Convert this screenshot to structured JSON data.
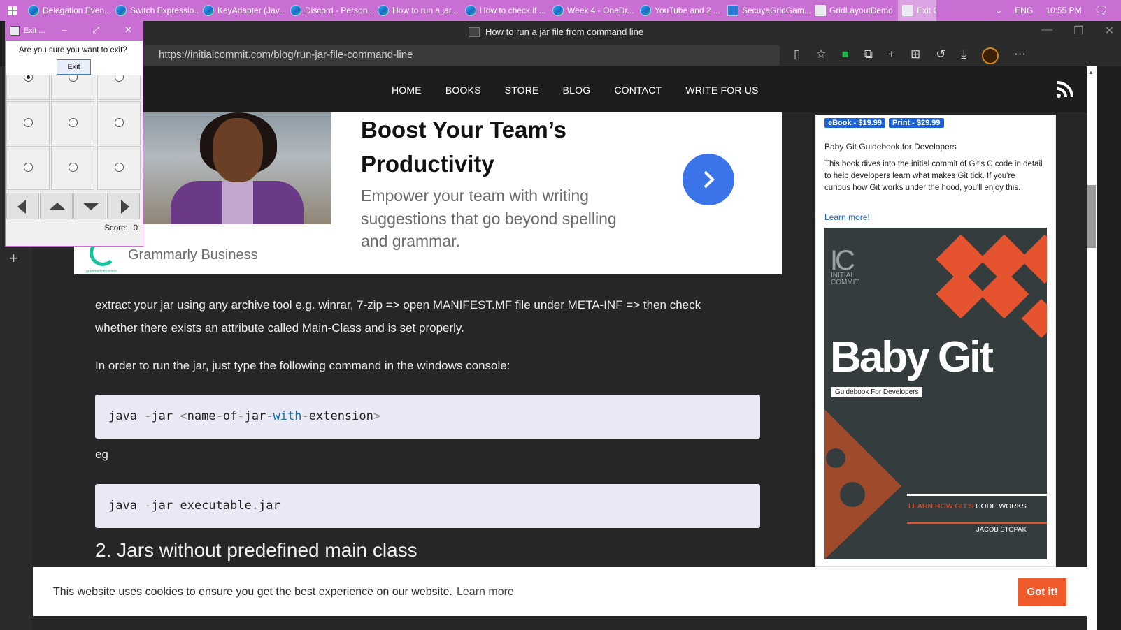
{
  "taskbar": {
    "items": [
      {
        "label": "Delegation Even..."
      },
      {
        "label": "Switch Expressio..."
      },
      {
        "label": "KeyAdapter (Jav..."
      },
      {
        "label": "Discord - Person..."
      },
      {
        "label": "How to run a jar..."
      },
      {
        "label": "How to check if ..."
      },
      {
        "label": "Week 4 - OneDr..."
      },
      {
        "label": "YouTube and 2 ..."
      },
      {
        "label": "SecuyaGridGam..."
      },
      {
        "label": "GridLayoutDemo"
      },
      {
        "label": "Exit G..."
      }
    ],
    "language": "ENG",
    "time": "10:55 PM"
  },
  "browser": {
    "title": "How to run a jar file from command line",
    "url": "https://initialcommit.com/blog/run-jar-file-command-line"
  },
  "site": {
    "nav": [
      "HOME",
      "BOOKS",
      "STORE",
      "BLOG",
      "CONTACT",
      "WRITE FOR US"
    ]
  },
  "ad": {
    "headline": "Boost Your Team’s Productivity",
    "body": "Empower your team with writing suggestions that go beyond spelling and grammar.",
    "brand": "Grammarly Business",
    "logo_sub": "grammarly business"
  },
  "article": {
    "p1": "extract your jar using any archive tool e.g. winrar, 7-zip => open MANIFEST.MF file under META-INF => then check whether there exists an attribute called Main-Class and is set properly.",
    "p2": "In order to run the jar, just type the following command in the windows console:",
    "code1": {
      "a": "java ",
      "b": "-",
      "c": "jar ",
      "d": "<",
      "e": "name",
      "f": "-",
      "g": "of",
      "h": "-",
      "i": "jar",
      "j": "-",
      "k": "with",
      "l": "-",
      "m": "extension",
      "n": ">"
    },
    "eg": "eg",
    "code2": {
      "a": "java ",
      "b": "-",
      "c": "jar executable",
      "d": ".",
      "e": "jar"
    },
    "h2": "2. Jars without predefined main class"
  },
  "book": {
    "ebook": "eBook - $19.99",
    "print": "Print - $29.99",
    "title": "Baby Git Guidebook for Developers",
    "desc": "This book dives into the initial commit of Git's C code in detail to help developers learn what makes Git tick. If you're curious how Git works under the hood, you'll enjoy this.",
    "learn": "Learn more!",
    "cover": {
      "logo": "IC",
      "logo_text_1": "INITIAL",
      "logo_text_2": "COMMIT",
      "title": "Baby Git",
      "subtitle": "Guidebook For Developers",
      "tag_a": "LEARN HOW GIT'S ",
      "tag_b": "CODE WORKS",
      "author": "JACOB STOPAK"
    }
  },
  "cookie": {
    "message": "This website uses cookies to ensure you get the best experience on our website.",
    "learn": "Learn more",
    "button": "Got it!"
  },
  "game": {
    "title": "Exit ...",
    "question": "Are you sure you want to exit?",
    "exit_button": "Exit",
    "score_label": "Score:",
    "score_value": "0"
  },
  "colors": {
    "taskbar": "#c96fd3",
    "accent_blue": "#3b73e8",
    "cookie_button": "#f05b2b",
    "badge": "#1e63d6"
  }
}
